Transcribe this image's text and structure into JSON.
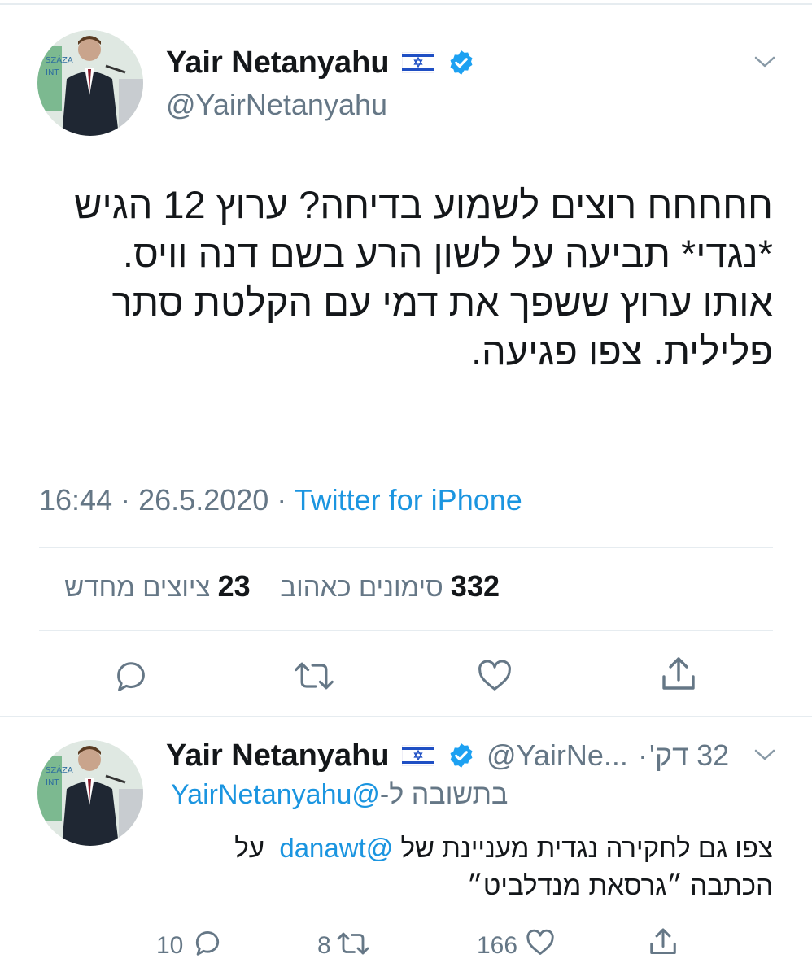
{
  "main_tweet": {
    "author_name": "Yair Netanyahu",
    "author_handle": "@YairNetanyahu",
    "text_lines": [
      "חחחחח רוצים לשמוע בדיחה? ערוץ 12 הגיש",
      "*נגדי* תביעה על לשון הרע בשם דנה וויס.",
      "אותו ערוץ ששפך את דמי עם הקלטת סתר",
      "פלילית. צפו פגיעה."
    ],
    "time": "16:44",
    "date": "26.5.2020",
    "separator": "·",
    "source": "Twitter for iPhone",
    "stats": {
      "retweets_count": "332",
      "retweets_label": "סימונים כאהוב",
      "likes_count": "23",
      "likes_label": "ציוצים מחדש"
    }
  },
  "reply_tweet": {
    "author_name": "Yair Netanyahu",
    "handle_truncated": "@YairNe...",
    "separator": "·",
    "time_ago": "32 דק'",
    "replying_to_label": "בתשובה ל-",
    "replying_to_handle": "@YairNetanyahu",
    "text_line1_start": "צפו גם לחקירה נגדית מעניינת של",
    "text_mention": "@danawt",
    "text_line1_end": "על",
    "text_line2": "הכתבה ״גרסאת מנדלביט״",
    "reply_count": "10",
    "retweet_count": "8",
    "like_count": "166"
  },
  "colors": {
    "link": "#1b95e0",
    "secondary_text": "#657786",
    "verified": "#1da1f2",
    "divider": "#e6ecf0"
  },
  "icons": [
    "israel-flag-icon",
    "verified-badge-icon",
    "chevron-down-icon",
    "reply-icon",
    "retweet-icon",
    "like-icon",
    "share-icon"
  ]
}
